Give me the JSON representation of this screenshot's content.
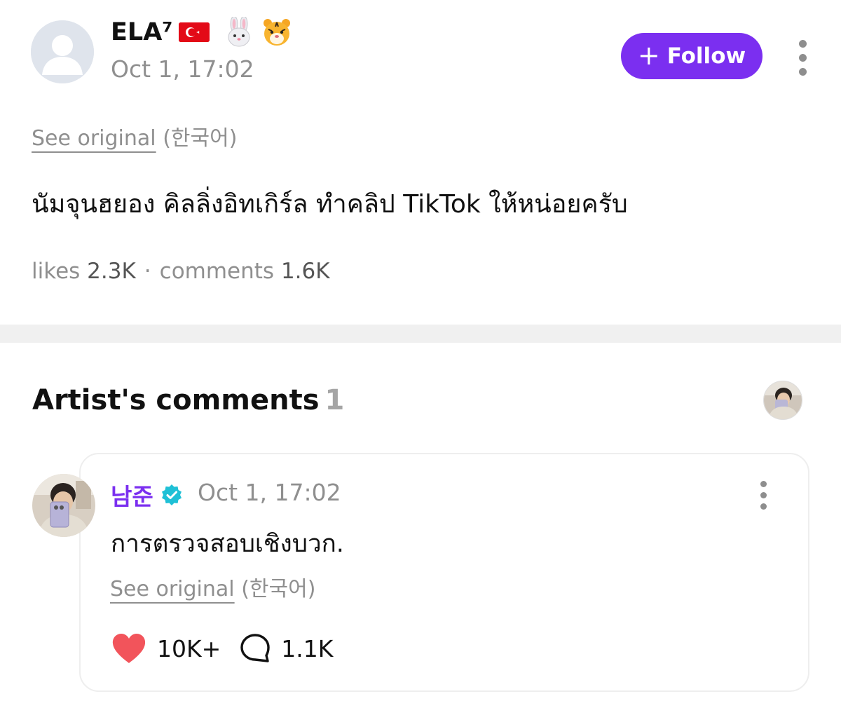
{
  "post": {
    "author_name": "ELA⁷",
    "author_flag": "turkey-flag",
    "author_emoji_badges": [
      "rabbit-face",
      "tiger-face"
    ],
    "time": "Oct 1, 17:02",
    "follow_label": "Follow",
    "see_original_label": "See original",
    "original_language": "(한국어)",
    "body": "นัมจุนฮยอง คิลลิ่งอิทเกิร์ล ทำคลิป TikTok ให้หน่อยครับ",
    "likes_label": "likes",
    "likes_value": "2.3K",
    "stats_separator": "·",
    "comments_label": "comments",
    "comments_value": "1.6K"
  },
  "artist_comments": {
    "title": "Artist's comments",
    "count": "1",
    "comment": {
      "author": "남준",
      "verified": true,
      "time": "Oct 1, 17:02",
      "body": "การตรวจสอบเชิงบวก.",
      "see_original_label": "See original",
      "original_language": "(한국어)",
      "likes": "10K+",
      "replies": "1.1K"
    }
  },
  "colors": {
    "accent": "#7b2ff0",
    "muted_text": "#8f8f8f",
    "heart": "#f2545b",
    "verified": "#1fc0d6",
    "divider": "#f0f0f0"
  }
}
